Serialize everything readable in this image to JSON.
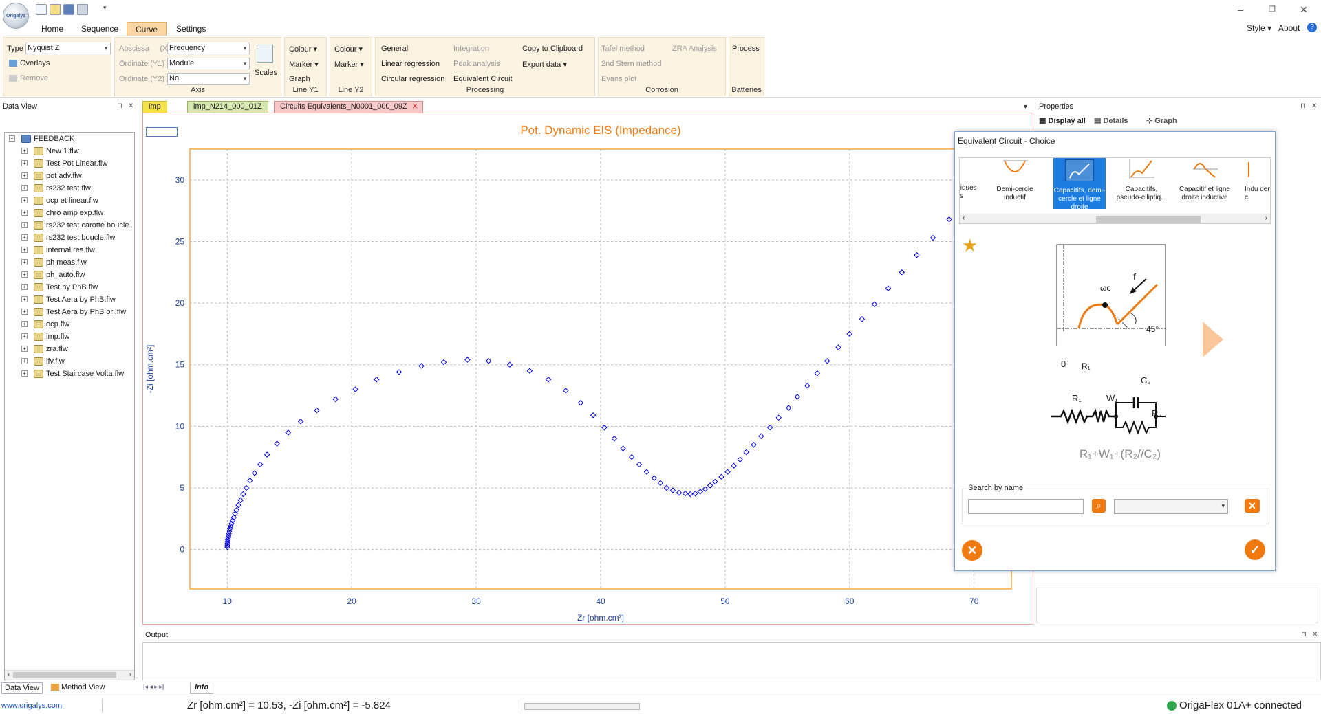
{
  "ribbon_tabs": [
    "Home",
    "Sequence",
    "Curve",
    "Settings"
  ],
  "active_tab": "Curve",
  "top_right": {
    "style": "Style",
    "about": "About"
  },
  "type": {
    "label": "Type",
    "value": "Nyquist Z"
  },
  "overlays": "Overlays",
  "remove": "Remove",
  "axis": {
    "abscissa_label": "Abscissa",
    "abscissa_tag": "(X)",
    "abscissa_value": "Frequency",
    "ordinate1_label": "Ordinate (Y1)",
    "ordinate1_value": "Module",
    "ordinate2_label": "Ordinate (Y2)",
    "ordinate2_value": "No",
    "scales": "Scales",
    "group": "Axis"
  },
  "line_y1": {
    "colour": "Colour",
    "marker": "Marker",
    "graph": "Graph",
    "group": "Line Y1"
  },
  "line_y2": {
    "colour": "Colour",
    "marker": "Marker",
    "group": "Line Y2"
  },
  "processing": {
    "general": "General",
    "linear": "Linear regression",
    "circular": "Circular regression",
    "integration": "Integration",
    "peak": "Peak analysis",
    "equivalent": "Equivalent Circuit",
    "copy": "Copy to Clipboard",
    "export": "Export data",
    "group": "Processing"
  },
  "corrosion": {
    "tafel": "Tafel method",
    "stern": "2nd Stern method",
    "evans": "Evans plot",
    "zra": "ZRA Analysis",
    "group": "Corrosion"
  },
  "batteries": {
    "process": "Process",
    "group": "Batteries"
  },
  "data_view": {
    "title": "Data View",
    "root": "FEEDBACK",
    "items": [
      "New 1.flw",
      "Test Pot Linear.flw",
      "pot adv.flw",
      "rs232 test.flw",
      "ocp et linear.flw",
      "chro amp exp.flw",
      "rs232 test carotte boucle.",
      "rs232 test boucle.flw",
      "internal res.flw",
      "ph meas.flw",
      "ph_auto.flw",
      "Test by PhB.flw",
      "Test Aera by PhB.flw",
      "Test Aera by PhB ori.flw",
      "ocp.flw",
      "imp.flw",
      "zra.flw",
      "ifv.flw",
      "Test Staircase Volta.flw"
    ],
    "tab_data": "Data View",
    "tab_method": "Method View"
  },
  "doc_tabs": [
    "imp",
    "imp_N214_000_01Z",
    "Circuits Equivalents_N0001_000_09Z"
  ],
  "properties": {
    "title": "Properties",
    "display_all": "Display all",
    "details": "Details",
    "graph": "Graph"
  },
  "chart_data": {
    "type": "scatter",
    "title": "Pot. Dynamic EIS (Impedance)",
    "xlabel": "Zr [ohm.cm²]",
    "ylabel": "-Zi [ohm.cm²]",
    "xlim": [
      7,
      73
    ],
    "ylim": [
      -3.2,
      32.5
    ],
    "xticks": [
      10,
      20,
      30,
      40,
      50,
      60,
      70
    ],
    "yticks": [
      0,
      5,
      10,
      15,
      20,
      25,
      30
    ],
    "grid": true,
    "color": "#0000ee",
    "x": [
      10.0,
      10.01,
      10.02,
      10.03,
      10.05,
      10.07,
      10.1,
      10.13,
      10.17,
      10.22,
      10.28,
      10.35,
      10.43,
      10.52,
      10.63,
      10.75,
      10.9,
      11.07,
      11.28,
      11.53,
      11.83,
      12.2,
      12.65,
      13.2,
      14.0,
      14.9,
      15.9,
      17.2,
      18.7,
      20.3,
      22.0,
      23.8,
      25.6,
      27.4,
      29.3,
      31.0,
      32.7,
      34.3,
      35.8,
      37.2,
      38.4,
      39.4,
      40.3,
      41.1,
      41.8,
      42.5,
      43.1,
      43.7,
      44.3,
      44.8,
      45.3,
      45.8,
      46.3,
      46.8,
      47.2,
      47.6,
      48.0,
      48.4,
      48.8,
      49.2,
      49.7,
      50.2,
      50.7,
      51.2,
      51.7,
      52.3,
      52.9,
      53.6,
      54.3,
      55.1,
      55.8,
      56.6,
      57.4,
      58.2,
      59.1,
      60.0,
      61.0,
      62.0,
      63.1,
      64.2,
      65.4,
      66.7,
      68.0
    ],
    "y": [
      0.2,
      0.35,
      0.5,
      0.65,
      0.8,
      0.95,
      1.1,
      1.3,
      1.5,
      1.7,
      1.9,
      2.1,
      2.35,
      2.6,
      2.9,
      3.2,
      3.6,
      4.0,
      4.5,
      5.0,
      5.6,
      6.2,
      6.9,
      7.7,
      8.6,
      9.5,
      10.4,
      11.3,
      12.2,
      13.0,
      13.8,
      14.4,
      14.9,
      15.2,
      15.4,
      15.3,
      15.0,
      14.5,
      13.8,
      12.9,
      11.9,
      10.9,
      9.9,
      9.0,
      8.2,
      7.5,
      6.9,
      6.3,
      5.8,
      5.4,
      5.0,
      4.8,
      4.6,
      4.55,
      4.5,
      4.55,
      4.7,
      4.9,
      5.2,
      5.5,
      5.9,
      6.3,
      6.8,
      7.3,
      7.9,
      8.5,
      9.2,
      9.9,
      10.7,
      11.5,
      12.4,
      13.3,
      14.3,
      15.3,
      16.4,
      17.5,
      18.7,
      19.9,
      21.2,
      22.5,
      23.9,
      25.3,
      26.8
    ]
  },
  "dialog": {
    "title": "Equivalent Circuit - Choice",
    "choices": [
      {
        "label": "tiques\n's",
        "selected": false
      },
      {
        "label": "Demi-cercle inductif",
        "selected": false
      },
      {
        "label": "Capacitifs, demi-cercle et ligne droite",
        "selected": true
      },
      {
        "label": "Capacitifs, pseudo-elliptiq...",
        "selected": false
      },
      {
        "label": "Capacitif et ligne droite inductive",
        "selected": false
      },
      {
        "label": "Indu demi-c",
        "selected": false
      }
    ],
    "formula": "R₁+W₁+(R₂//C₂)",
    "search_label": "Search by name",
    "search_value": "",
    "filter_value": "",
    "diagram": {
      "wc": "ωc",
      "f": "f",
      "angle": "45°",
      "zero": "0",
      "r1": "R₁",
      "c2": "C₂",
      "w1": "W₁",
      "r2": "R₂"
    }
  },
  "output": {
    "title": "Output",
    "tab": "Info"
  },
  "status": {
    "link": "www.origalys.com",
    "coords": "Zr [ohm.cm²] = 10.53, -Zi [ohm.cm²] = -5.824",
    "device": "OrigaFlex 01A+ connected"
  },
  "accent": "#ff8c1a",
  "selection_blue": "#1c7ce0"
}
